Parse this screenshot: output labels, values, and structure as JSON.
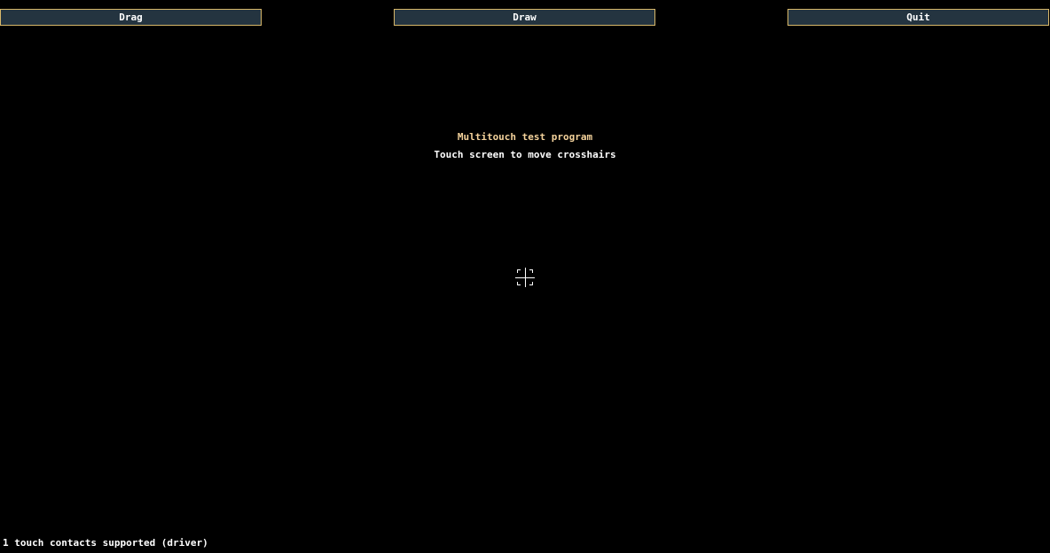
{
  "toolbar": {
    "drag_label": "Drag",
    "draw_label": "Draw",
    "quit_label": "Quit"
  },
  "main": {
    "title": "Multitouch test program",
    "subtitle": "Touch screen to move crosshairs",
    "cursor_icon": "crosshair-icon"
  },
  "status": {
    "text": "1 touch contacts supported (driver)"
  },
  "colors": {
    "background": "#000000",
    "button_fill": "#243440",
    "button_border": "#d8b86a",
    "title_text": "#f4d29b",
    "text": "#ffffff"
  }
}
